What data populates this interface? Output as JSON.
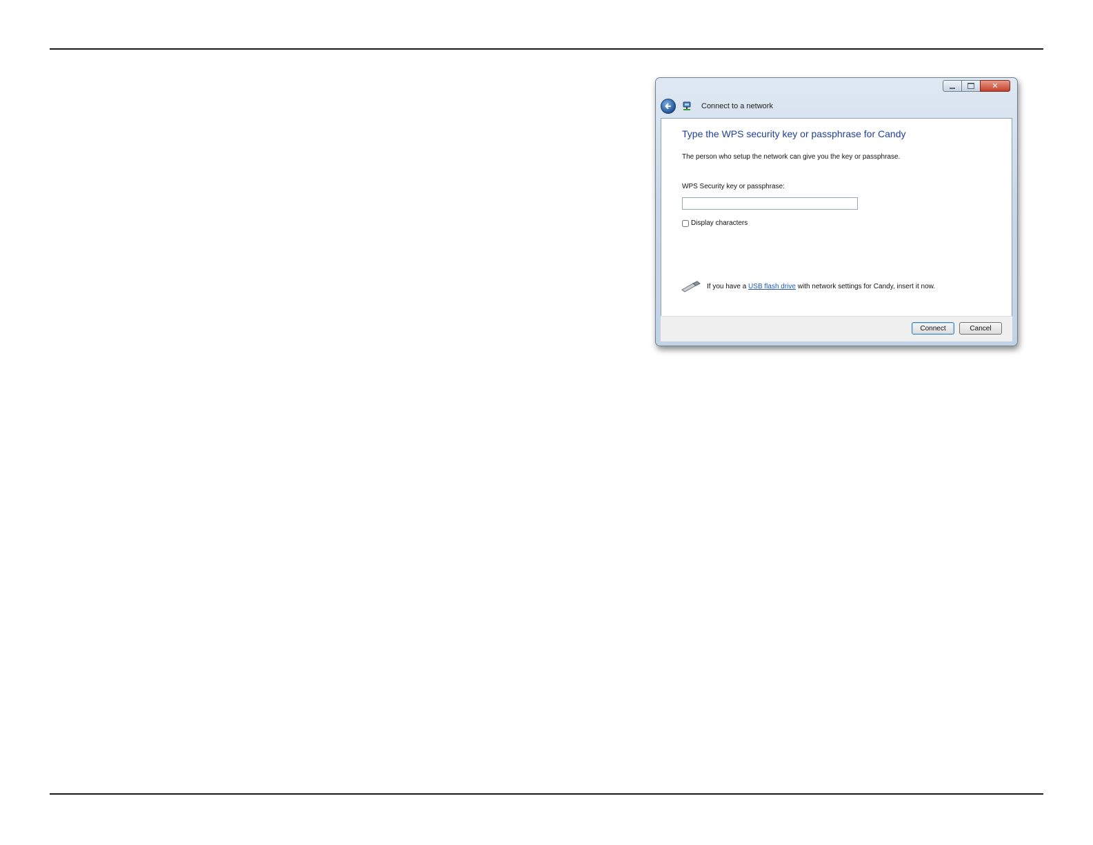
{
  "window": {
    "title": "Connect to a network",
    "controls": [
      "minimize-icon",
      "maximize-icon",
      "close-icon"
    ]
  },
  "content": {
    "heading": "Type the WPS security key or passphrase for Candy",
    "description": "The person who setup the network can give you the key or passphrase.",
    "key_label": "WPS Security key or passphrase:",
    "key_value": "",
    "display_characters_label": "Display characters",
    "display_characters_checked": false,
    "usb_prefix": "If you have a ",
    "usb_link": "USB flash drive",
    "usb_suffix": " with network settings for Candy, insert it now."
  },
  "footer": {
    "connect_label": "Connect",
    "cancel_label": "Cancel"
  }
}
